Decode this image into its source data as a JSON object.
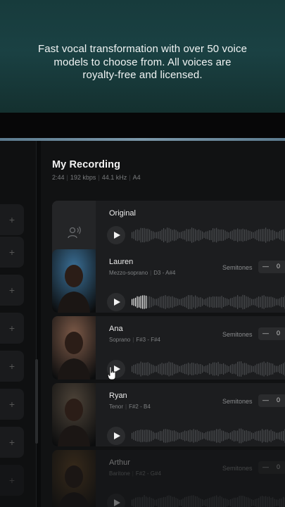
{
  "hero": {
    "text": "Fast vocal transformation with over 50 voice models to choose from. All voices are royalty-free and licensed."
  },
  "recording": {
    "title": "My Recording",
    "duration": "2:44",
    "bitrate": "192 kbps",
    "sample_rate": "44.1 kHz",
    "pitch": "A4"
  },
  "sidebar": {
    "add_label": "+"
  },
  "semitones_label": "Semitones",
  "original": {
    "name": "Original"
  },
  "voices": [
    {
      "name": "Lauren",
      "type": "Mezzo-soprano",
      "range": "D3 - A#4",
      "semitones": "0",
      "minus": "—",
      "avatar_color": "#3a6f96"
    },
    {
      "name": "Ana",
      "type": "Soprano",
      "range": "F#3 - F#4",
      "semitones": "0",
      "minus": "—",
      "avatar_color": "#7d5a48"
    },
    {
      "name": "Ryan",
      "type": "Tenor",
      "range": "F#2 - B4",
      "semitones": "0",
      "minus": "—",
      "avatar_color": "#4d4338"
    },
    {
      "name": "Arthur",
      "type": "Baritone",
      "range": "F#2 - G#4",
      "semitones": "0",
      "minus": "—",
      "avatar_color": "#6a4a26"
    }
  ]
}
